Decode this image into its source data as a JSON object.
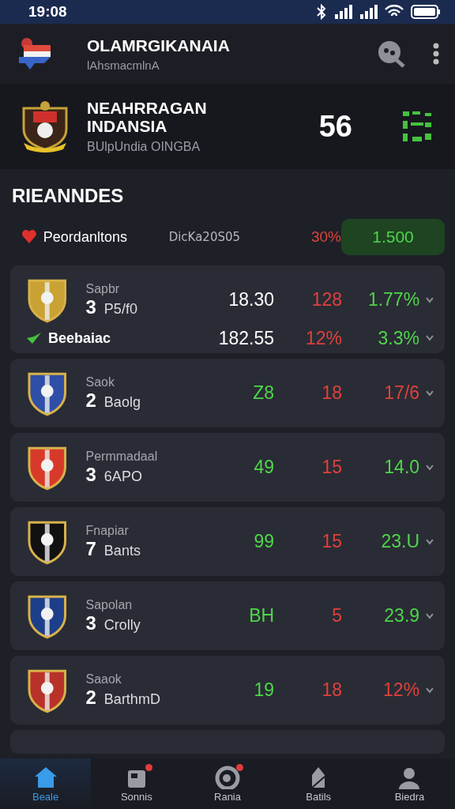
{
  "status_bar": {
    "time": "19:08"
  },
  "header": {
    "title": "OLAMRGIKANAIA",
    "subtitle": "lAhsmacmlnA"
  },
  "team": {
    "name": "NEAHRRAGAN INDANSIA",
    "subtitle": "BUlpUndia OINGBA",
    "score": "56"
  },
  "section": {
    "title": "RIEANNDES"
  },
  "summary": {
    "label": "Peordanltons",
    "code": "DicKa20S05",
    "change": "30%",
    "value": "1.500"
  },
  "cards": [
    {
      "color": "#c9a233",
      "label": "Sapbr",
      "rank": "3",
      "name": "P5/f0",
      "values": [
        {
          "text": "18.30",
          "kind": "neutral"
        },
        {
          "text": "128",
          "kind": "down"
        },
        {
          "text": "1.77%",
          "kind": "up"
        }
      ],
      "sub_row": {
        "label": "Beebaiac",
        "values": [
          {
            "text": "182.55",
            "kind": "neutral"
          },
          {
            "text": "12%",
            "kind": "down"
          },
          {
            "text": "3.3%",
            "kind": "up"
          }
        ]
      }
    },
    {
      "color": "#2f4ea8",
      "label": "Saok",
      "rank": "2",
      "name": "Baolg",
      "values": [
        {
          "text": "Z8",
          "kind": "up"
        },
        {
          "text": "18",
          "kind": "down"
        },
        {
          "text": "17/6",
          "kind": "down"
        }
      ]
    },
    {
      "color": "#d83a2a",
      "label": "Permmadaal",
      "rank": "3",
      "name": "6APO",
      "values": [
        {
          "text": "49",
          "kind": "up"
        },
        {
          "text": "15",
          "kind": "down"
        },
        {
          "text": "14.0",
          "kind": "up"
        }
      ]
    },
    {
      "color": "#111111",
      "label": "Fnapiar",
      "rank": "7",
      "name": "Bants",
      "values": [
        {
          "text": "99",
          "kind": "up"
        },
        {
          "text": "15",
          "kind": "down"
        },
        {
          "text": "23.U",
          "kind": "up"
        }
      ]
    },
    {
      "color": "#1d3f8a",
      "label": "Sapolan",
      "rank": "3",
      "name": "Crolly",
      "values": [
        {
          "text": "BH",
          "kind": "up"
        },
        {
          "text": "5",
          "kind": "down"
        },
        {
          "text": "23.9",
          "kind": "up"
        }
      ]
    },
    {
      "color": "#b8322a",
      "label": "Saaok",
      "rank": "2",
      "name": "BarthmD",
      "values": [
        {
          "text": "19",
          "kind": "up"
        },
        {
          "text": "18",
          "kind": "down"
        },
        {
          "text": "12%",
          "kind": "down"
        }
      ]
    }
  ],
  "bottom_nav": [
    {
      "label": "Beale",
      "kind": "home",
      "selected": true,
      "badge": false
    },
    {
      "label": "Sonnis",
      "kind": "box",
      "selected": false,
      "badge": true
    },
    {
      "label": "Rania",
      "kind": "ring",
      "selected": false,
      "badge": true
    },
    {
      "label": "Batils",
      "kind": "tower",
      "selected": false,
      "badge": false
    },
    {
      "label": "Biedra",
      "kind": "person",
      "selected": false,
      "badge": false
    }
  ]
}
